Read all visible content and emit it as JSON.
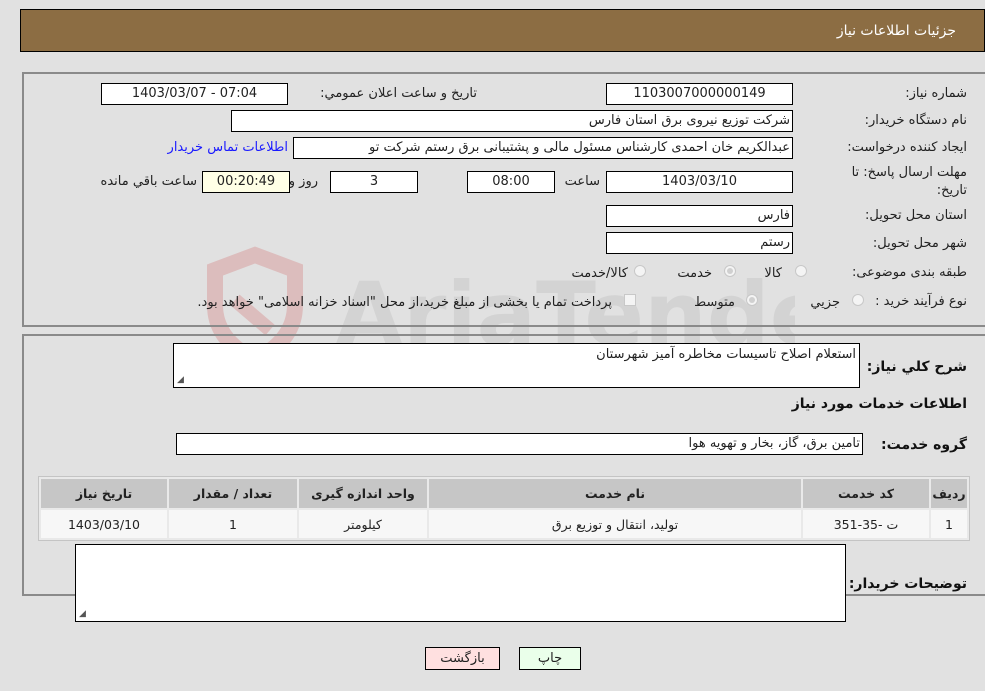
{
  "header": {
    "title": "جزئیات اطلاعات نیاز"
  },
  "details": {
    "need_number_label": "شماره نیاز:",
    "need_number": "1103007000000149",
    "announce_label": "تاریخ و ساعت اعلان عمومي:",
    "announce_value": "1403/03/07 - 07:04",
    "buyer_org_label": "نام دستگاه خریدار:",
    "buyer_org": "شرکت توزیع نیروی برق استان فارس",
    "creator_label": "ایجاد کننده درخواست:",
    "creator": "عبدالکریم خان احمدی کارشناس مسئول مالی و پشتیبانی برق رستم شرکت تو",
    "contact_link": "اطلاعات تماس خریدار",
    "deadline_label_line1": "مهلت ارسال پاسخ: تا",
    "deadline_label_line2": "تاریخ:",
    "deadline_date": "1403/03/10",
    "time_label": "ساعت",
    "deadline_time": "08:00",
    "days_value": "3",
    "days_label": "روز و",
    "remaining_time": "00:20:49",
    "remaining_label": "ساعت باقي مانده",
    "province_label": "استان محل تحویل:",
    "province": "فارس",
    "city_label": "شهر محل تحویل:",
    "city": "رستم",
    "category_label": "طبقه بندی موضوعی:",
    "category_options": [
      {
        "label": "کالا",
        "checked": false
      },
      {
        "label": "خدمت",
        "checked": true
      },
      {
        "label": "کالا/خدمت",
        "checked": false
      }
    ],
    "process_label": "نوع فرآیند خرید :",
    "process_options": [
      {
        "label": "جزيي",
        "checked": false
      },
      {
        "label": "متوسط",
        "checked": true
      }
    ],
    "treasury_note": "پرداخت تمام یا بخشی از مبلغ خرید،از محل \"اسناد خزانه اسلامی\" خواهد بود."
  },
  "summary": {
    "description_label": "شرح کلي نياز:",
    "description": "استعلام اصلاح تاسیسات مخاطره آمیز شهرستان",
    "services_title": "اطلاعات خدمات مورد نیاز",
    "service_group_label": "گروه خدمت:",
    "service_group": "تامین برق، گاز، بخار و تهویه هوا",
    "table": {
      "headers": [
        "ردیف",
        "کد خدمت",
        "نام خدمت",
        "واحد اندازه گیری",
        "تعداد / مقدار",
        "تاریخ نیاز"
      ],
      "rows": [
        [
          "1",
          "ت -35-351",
          "تولید، انتقال و توزیع برق",
          "کیلومتر",
          "1",
          "1403/03/10"
        ]
      ]
    },
    "buyer_notes_label": "توضیحات خریدار:",
    "buyer_notes": ""
  },
  "buttons": {
    "print": "چاپ",
    "back": "بازگشت"
  },
  "watermark": {
    "text": "AriaTender.neT"
  }
}
